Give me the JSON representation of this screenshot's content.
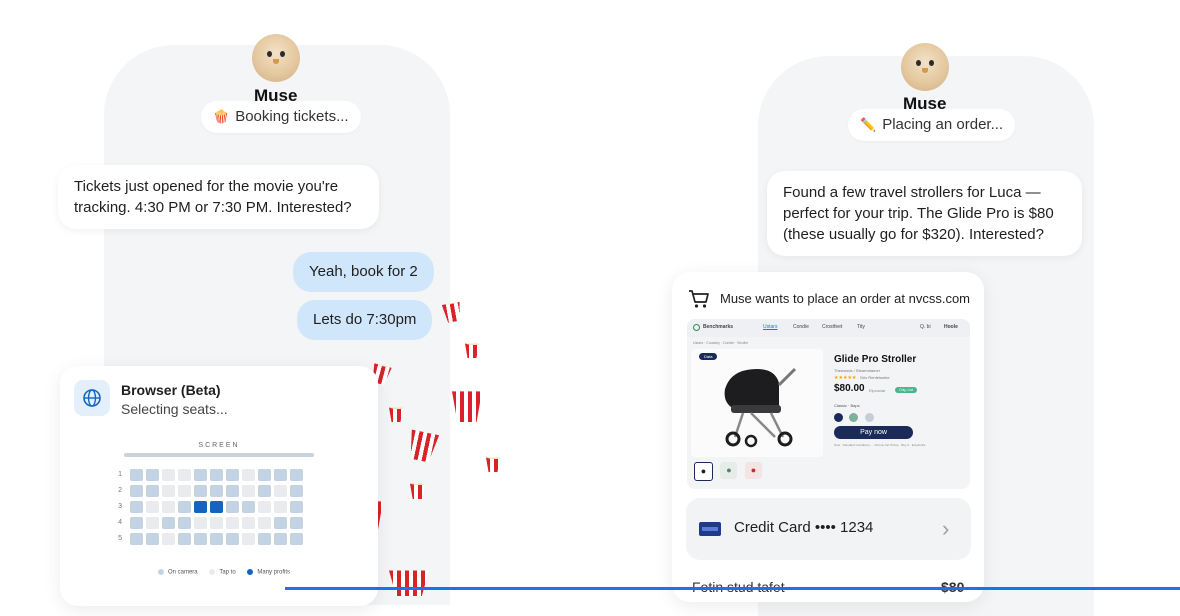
{
  "left_chat": {
    "agent_name": "Muse",
    "status_icon": "popcorn-icon",
    "status_text": "Booking tickets...",
    "incoming_message": "Tickets just opened for the movie you're tracking. 4:30 PM or 7:30 PM. Interested?",
    "reply_1": "Yeah, book for 2",
    "reply_2": "Lets do 7:30pm",
    "browser_card": {
      "title": "Browser (Beta)",
      "subtitle": "Selecting seats...",
      "screen_label": "SCREEN",
      "rows": [
        "1",
        "2",
        "3",
        "4",
        "5"
      ],
      "legend": [
        "On camera",
        "Tap to",
        "Many profits"
      ]
    }
  },
  "right_chat": {
    "agent_name": "Muse",
    "status_icon": "pencil-icon",
    "status_text": "Placing an order...",
    "incoming_message": "Found a few travel strollers for Luca — perfect for your trip. The Glide Pro is $80 (these usually go for $320). Interested?",
    "order_card": {
      "header": "Muse wants to place an order at nvcss.com",
      "site": {
        "brand": "Benchmarks",
        "nav": [
          "Ustars",
          "Condie",
          "Crostfeet",
          "Tity"
        ],
        "nav_right": [
          "Q. bi",
          "Hoole"
        ],
        "breadcrumb": "Ustars · Crossley · Condie · Stroller",
        "badge": "Data",
        "product_title": "Glide Pro Stroller",
        "product_sub": "Thewoods / Stearmdamer",
        "rating": "Grix Renfelsmbe",
        "price": "$80.00",
        "price_old": "Eipcoclar",
        "price_tag": "Orig. List",
        "colors_label": "Classic · Baps",
        "pay_button": "Pay now",
        "fine_print": "Now · Standard Conditions · · Chrono fort Pricep · Buy 2 · Empiricitis"
      },
      "payment_method": "Credit Card •••• 1234",
      "line_item_label": "Fotin stud tafet",
      "line_item_price": "$80"
    }
  },
  "colors": {
    "accent": "#1a73e8",
    "bubble_out": "#cfe6fb",
    "pay_button": "#1b2a59",
    "selected_seat": "#1565c0"
  }
}
